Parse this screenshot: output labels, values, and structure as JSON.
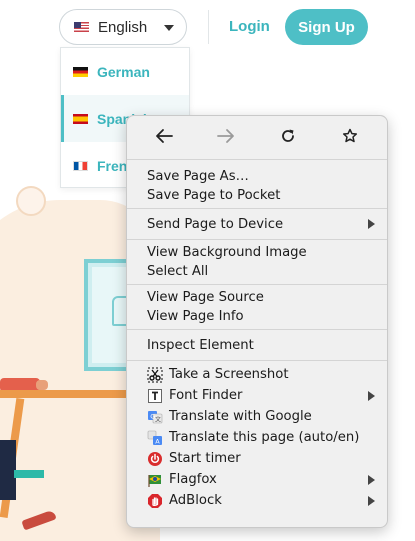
{
  "header": {
    "language_selected": "English",
    "login_label": "Login",
    "signup_label": "Sign Up",
    "accent_color": "#4ebfc6"
  },
  "language_menu": {
    "items": [
      {
        "label": "German",
        "flag": "flag-de-icon"
      },
      {
        "label": "Spanish",
        "flag": "flag-es-icon",
        "active": true
      },
      {
        "label": "French",
        "flag": "flag-fr-icon"
      }
    ]
  },
  "context_menu": {
    "nav": [
      "back-icon",
      "forward-icon",
      "reload-icon",
      "bookmark-star-icon"
    ],
    "items": {
      "save_page_as": "Save Page As…",
      "save_to_pocket": "Save Page to Pocket",
      "send_to_device": "Send Page to Device",
      "view_bg_image": "View Background Image",
      "select_all": "Select All",
      "view_source": "View Page Source",
      "view_info": "View Page Info",
      "inspect": "Inspect Element",
      "screenshot": "Take a Screenshot",
      "font_finder": "Font Finder",
      "translate_google": "Translate with Google",
      "translate_page": "Translate this page (auto/en)",
      "start_timer": "Start timer",
      "flagfox": "Flagfox",
      "adblock": "AdBlock"
    }
  }
}
